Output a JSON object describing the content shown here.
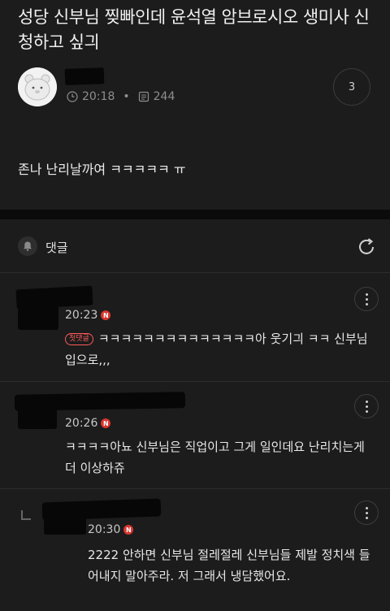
{
  "post": {
    "title": "성당 신부님 찢빠인데 윤석열 암브로시오 생미사 신청하고 싶긔",
    "time": "20:18",
    "views": "244",
    "comment_count": "3",
    "body": "존나 난리날까여 ㅋㅋㅋㅋㅋ ㅠ"
  },
  "comments_section": {
    "title": "댓글"
  },
  "comments": [
    {
      "time": "20:23",
      "badge": "N",
      "first_label": "첫댓글",
      "text": "ㅋㅋㅋㅋㅋㅋㅋㅋㅋㅋㅋㅋㅋㅋ아 웃기긔 ㅋㅋ 신부님 입으로,,,"
    },
    {
      "time": "20:26",
      "badge": "N",
      "text": "ㅋㅋㅋㅋ아뇨 신부님은 직업이고 그게 일인데요 난리치는게 더 이상하쥬"
    },
    {
      "time": "20:30",
      "badge": "N",
      "text": "2222 안하면 신부님 절레절레 신부님들 제발 정치색 들어내지 말아주라. 저 그래서 냉담했어요."
    }
  ]
}
